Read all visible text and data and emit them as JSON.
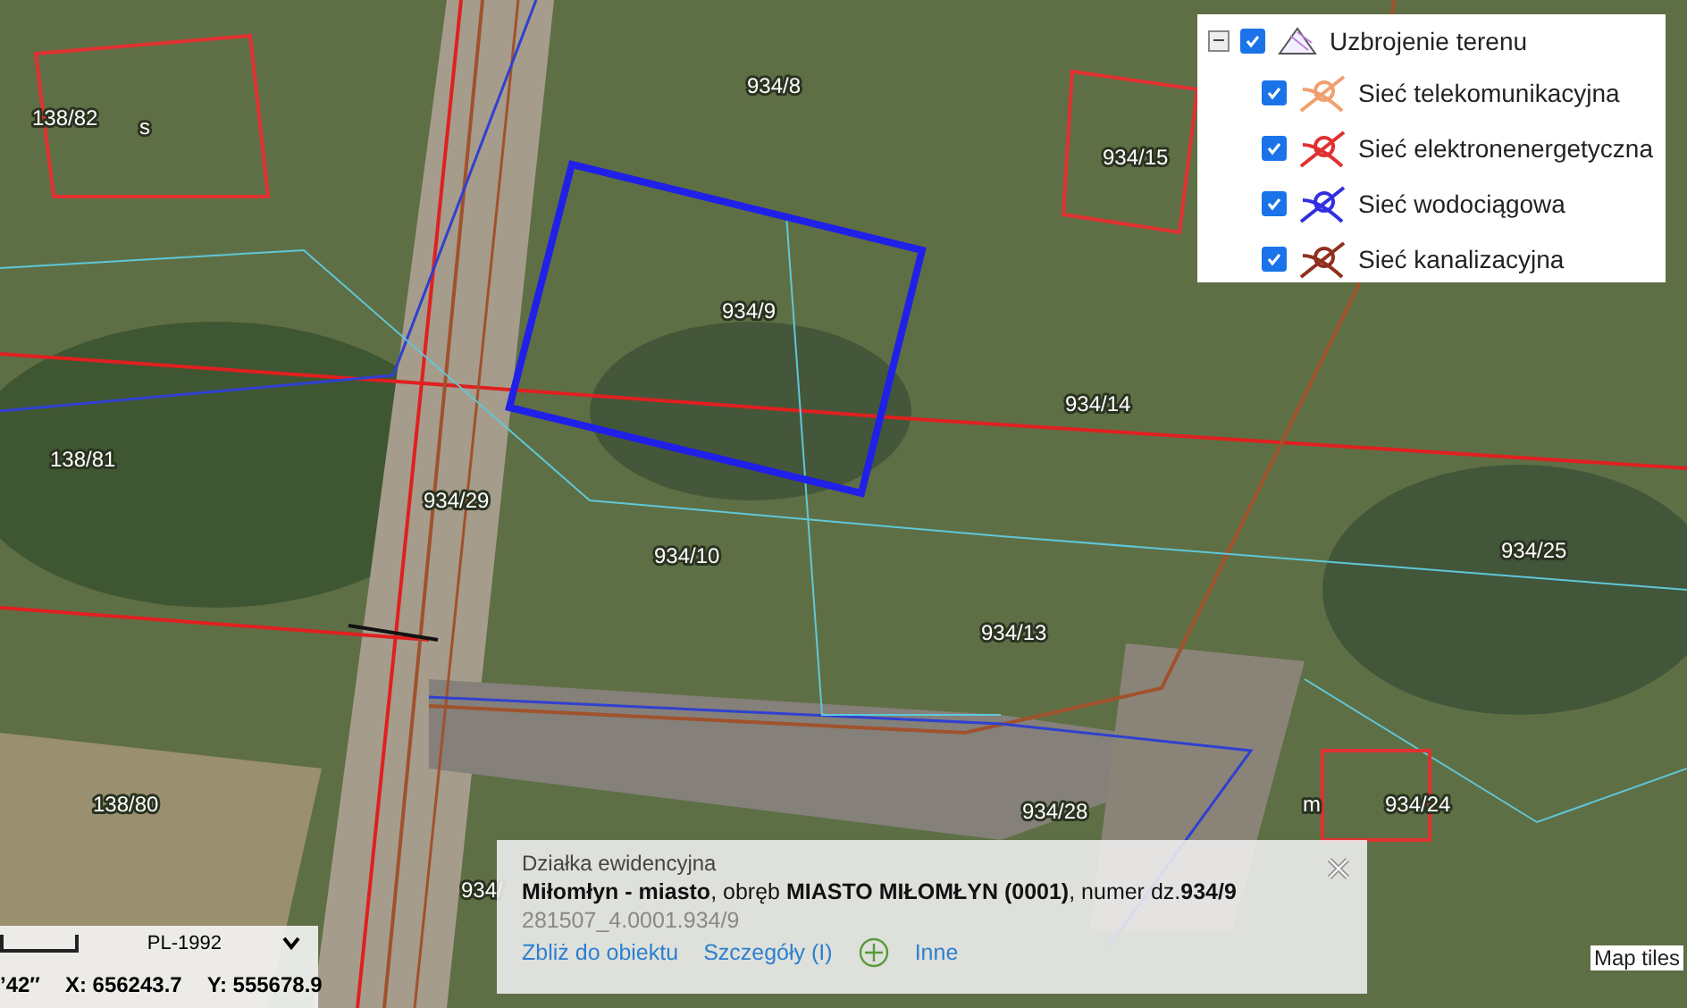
{
  "map": {
    "parcel_labels": [
      "934/8",
      "138/82",
      "s",
      "934/15",
      "934/9",
      "934/14",
      "138/81",
      "934/29",
      "934/10",
      "934/13",
      "934/25",
      "138/80",
      "m",
      "934/24",
      "934/28",
      "934/"
    ],
    "attribution": "Map tiles"
  },
  "legend": {
    "group": {
      "label": "Uzbrojenie terenu",
      "expanded": true,
      "checked": true
    },
    "layers": [
      {
        "label": "Sieć telekomunikacyjna",
        "checked": true,
        "color": "#f0a070"
      },
      {
        "label": "Sieć elektronenergetyczna",
        "checked": true,
        "color": "#e03030"
      },
      {
        "label": "Sieć wodociągowa",
        "checked": true,
        "color": "#3030e0"
      },
      {
        "label": "Sieć kanalizacyjna",
        "checked": true,
        "color": "#903020"
      }
    ]
  },
  "popup": {
    "title": "Działka ewidencyjna",
    "description": "**Miłomłyn - miasto**, obręb **MIASTO MIŁOMŁYN (0001)**, numer dz.**934/9**",
    "identifier": "281507_4.0001.934/9",
    "links": [
      "Zbliż do obiektu",
      "Szczegóły (I)",
      "Inne"
    ]
  },
  "coordinates": {
    "crs": "PL-1992",
    "partial": "’42″",
    "x": "X: 656243.7",
    "y": "Y: 555678.9"
  }
}
